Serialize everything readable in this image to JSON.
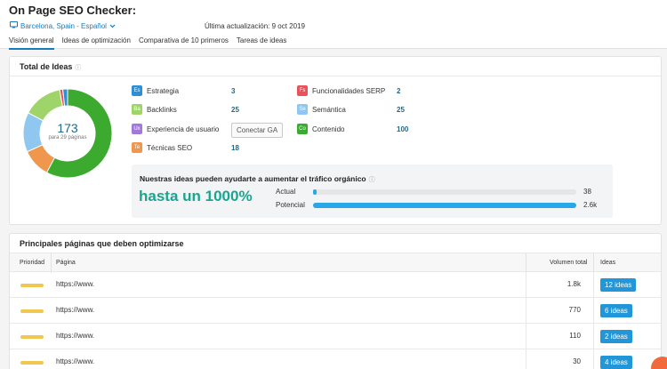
{
  "header": {
    "title": "On Page SEO Checker:",
    "location": "Barcelona, Spain - Español",
    "last_update": "Última actualización: 9 oct 2019",
    "tabs": [
      {
        "label": "Visión general",
        "active": true
      },
      {
        "label": "Ideas de optimización",
        "active": false
      },
      {
        "label": "Comparativa de 10 primeros",
        "active": false
      },
      {
        "label": "Tareas de ideas",
        "active": false
      }
    ]
  },
  "total": {
    "title": "Total de Ideas",
    "count": "173",
    "pages_sub": "para 29 páginas",
    "categories": [
      {
        "abbr": "Es",
        "label": "Estrategia",
        "value": "3",
        "color": "#2e8fd6"
      },
      {
        "abbr": "Ba",
        "label": "Backlinks",
        "value": "25",
        "color": "#9ed469"
      },
      {
        "abbr": "Ux",
        "label": "Experiencia de usuario",
        "button": "Conectar GA",
        "color": "#a17ad8"
      },
      {
        "abbr": "Te",
        "label": "Técnicas SEO",
        "value": "18",
        "color": "#f0974e"
      },
      {
        "abbr": "Fs",
        "label": "Funcionalidades SERP",
        "value": "2",
        "color": "#e8535b"
      },
      {
        "abbr": "Se",
        "label": "Semántica",
        "value": "25",
        "color": "#8fc7f0"
      },
      {
        "abbr": "Co",
        "label": "Contenido",
        "value": "100",
        "color": "#3caa2f"
      }
    ],
    "donut_segments": [
      {
        "name": "Contenido",
        "value": 100,
        "color": "#3caa2f"
      },
      {
        "name": "Técnicas SEO",
        "value": 18,
        "color": "#f0974e"
      },
      {
        "name": "Semántica",
        "value": 25,
        "color": "#8fc7f0"
      },
      {
        "name": "Backlinks",
        "value": 25,
        "color": "#9ed469"
      },
      {
        "name": "Funcionalidades SERP",
        "value": 2,
        "color": "#e8535b"
      },
      {
        "name": "Estrategia",
        "value": 3,
        "color": "#2e8fd6"
      }
    ]
  },
  "promo": {
    "text": "Nuestras ideas pueden ayudarte a aumentar el tráfico orgánico",
    "big": "hasta un 1000%",
    "actual_label": "Actual",
    "actual_value": "38",
    "actual_fraction": 0.015,
    "potential_label": "Potencial",
    "potential_value": "2.6k",
    "potential_fraction": 1.0
  },
  "pages": {
    "title": "Principales páginas que deben optimizarse",
    "columns": {
      "priority": "Prioridad",
      "page": "Página",
      "volume": "Volumen total",
      "ideas": "Ideas"
    },
    "rows": [
      {
        "url": "https://www.",
        "volume": "1.8k",
        "ideas": "12 ideas"
      },
      {
        "url": "https://www.",
        "volume": "770",
        "ideas": "6 ideas"
      },
      {
        "url": "https://www.",
        "volume": "110",
        "ideas": "2 ideas"
      },
      {
        "url": "https://www.",
        "volume": "30",
        "ideas": "4 ideas"
      }
    ]
  }
}
